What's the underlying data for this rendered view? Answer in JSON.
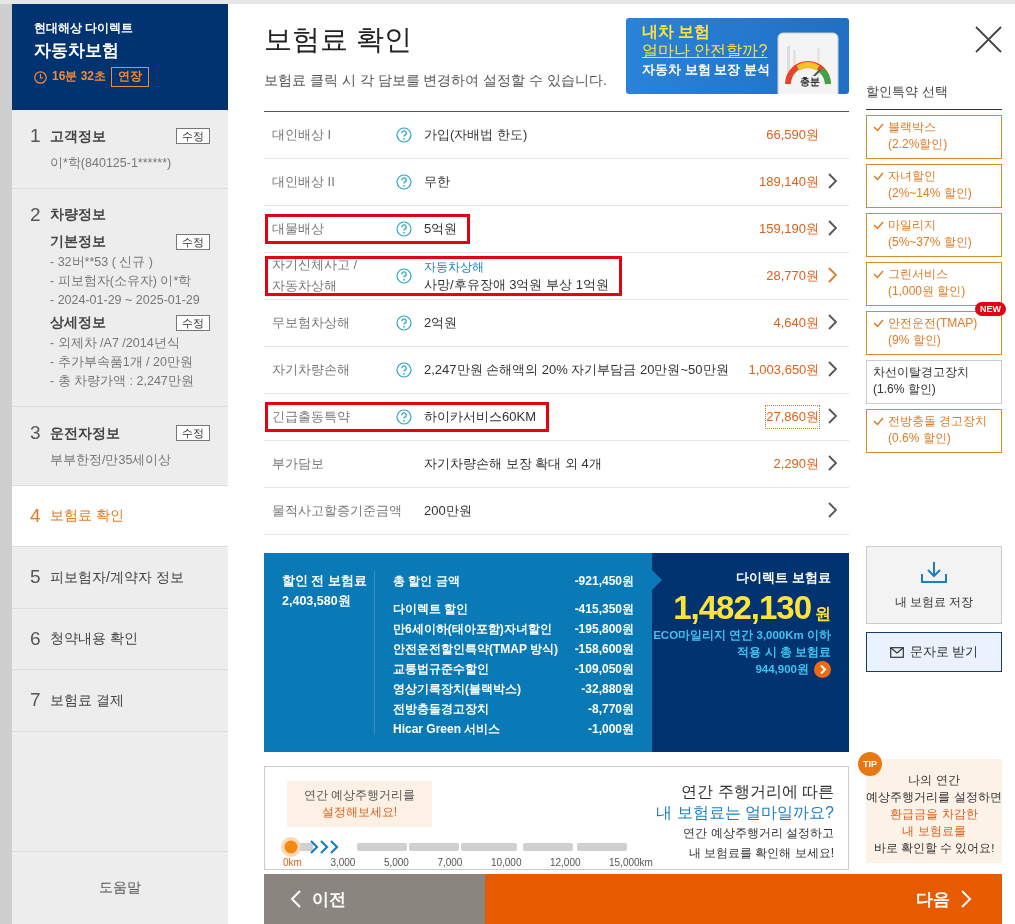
{
  "sidebar": {
    "brand": "현대해상 다이렉트",
    "product": "자동차보험",
    "timer": "16분 32초",
    "extend_button": "연장",
    "steps": [
      {
        "number": "1",
        "title": "고객정보",
        "selected": false,
        "edit_button": "수정",
        "lines": [
          "이*학(840125-1******)"
        ]
      },
      {
        "number": "2",
        "title": "차량정보",
        "selected": false,
        "sections": [
          {
            "title": "기본정보",
            "edit_button": "수정",
            "lines": [
              "- 32버**53 ( 신규 )",
              "- 피보험자(소유자) 이*학",
              "- 2024-01-29 ~ 2025-01-29"
            ]
          },
          {
            "title": "상세정보",
            "edit_button": "수정",
            "lines": [
              "- 외제차 /A7 /2014년식",
              "- 추가부속품1개 / 20만원",
              "- 총 차량가액 : 2,247만원"
            ]
          }
        ]
      },
      {
        "number": "3",
        "title": "운전자정보",
        "selected": false,
        "edit_button": "수정",
        "lines": [
          "부부한정/만35세이상"
        ]
      },
      {
        "number": "4",
        "title": "보험료 확인",
        "selected": true
      },
      {
        "number": "5",
        "title": "피보험자/계약자 정보",
        "selected": false
      },
      {
        "number": "6",
        "title": "청약내용 확인",
        "selected": false
      },
      {
        "number": "7",
        "title": "보험료 결제",
        "selected": false
      }
    ],
    "help": "도움말"
  },
  "header": {
    "title": "보험료 확인",
    "subtitle": "보험료 클릭 시 각 담보를 변경하여 설정할 수 있습니다.",
    "banner": {
      "line_1": "내차 보험",
      "line_2": "얼마나 안전할까?",
      "line_3": "자동차 보험 보장 분석",
      "gauge_label": "충분"
    }
  },
  "coverages": [
    {
      "label": "대인배상 I",
      "help": true,
      "value": "가입(자배법 한도)",
      "amount": "66,590원",
      "chevron": false,
      "highlighted": false
    },
    {
      "label": "대인배상 II",
      "help": true,
      "value": "무한",
      "amount": "189,140원",
      "chevron": true,
      "highlighted": false
    },
    {
      "label": "대물배상",
      "help": true,
      "value": "5억원",
      "amount": "159,190원",
      "chevron": true,
      "highlighted": true
    },
    {
      "label": "자기신체사고 / 자동차상해",
      "help": true,
      "note": "자동차상해",
      "value": "사망/후유장애 3억원 부상 1억원",
      "amount": "28,770원",
      "chevron": true,
      "highlighted": true,
      "hover": true
    },
    {
      "label": "무보험차상해",
      "help": true,
      "value": "2억원",
      "amount": "4,640원",
      "chevron": true,
      "highlighted": false
    },
    {
      "label": "자기차량손해",
      "help": true,
      "value": "2,247만원 손해액의 20% 자기부담금 20만원~50만원",
      "amount": "1,003,650원",
      "chevron": true,
      "highlighted": false
    },
    {
      "label": "긴급출동특약",
      "help": true,
      "value": "하이카서비스60KM",
      "amount": "27,860원",
      "chevron": true,
      "highlighted": true,
      "focused": true
    },
    {
      "label": "부가담보",
      "help": false,
      "value": "자기차량손해 보장 확대 외 4개",
      "amount": "2,290원",
      "chevron": true,
      "highlighted": false
    },
    {
      "label": "물적사고할증기준금액",
      "help": false,
      "value": "200만원",
      "chevron": true,
      "highlighted": false
    }
  ],
  "summary": {
    "before_label": "할인 전 보험료",
    "before_amount": "2,403,580원",
    "discounts": [
      {
        "kind": "total",
        "label": "총 할인 금액",
        "amount": "-921,450원"
      },
      {
        "kind": "item",
        "label": "다이렉트 할인",
        "amount": "-415,350원"
      },
      {
        "kind": "item",
        "label": "만6세이하(태아포함)자녀할인",
        "amount": "-195,800원"
      },
      {
        "kind": "item",
        "label": "안전운전할인특약(TMAP 방식)",
        "amount": "-158,600원"
      },
      {
        "kind": "item",
        "label": "교통법규준수할인",
        "amount": "-109,050원"
      },
      {
        "kind": "item",
        "label": "영상기록장치(블랙박스)",
        "amount": "-32,880원"
      },
      {
        "kind": "item",
        "label": "전방충돌경고장치",
        "amount": "-8,770원"
      },
      {
        "kind": "item",
        "label": "Hicar Green 서비스",
        "amount": "-1,000원"
      }
    ],
    "final_label": "다이렉트 보험료",
    "final_amount": "1,482,130",
    "final_unit": "원",
    "eco_lines": [
      "ECO마일리지 연간 3,000Km 이하",
      "적용 시 총 보험료"
    ],
    "eco_amount": "944,900원"
  },
  "mileage": {
    "prompt_line_1": "연간 예상주행거리를",
    "prompt_line_2": "설정해보세요!",
    "slider": {
      "level": 0
    },
    "ticks": [
      "0km",
      "3,000",
      "5,000",
      "7,000",
      "10,000",
      "12,000",
      "15,000km"
    ],
    "headline_1": "연간 주행거리에 따른",
    "headline_2": "내 보험료는 얼마일까요?",
    "hint_lines": [
      "연간 예상주행거리 설정하고",
      "내 보험료를 확인해 보세요!"
    ]
  },
  "discount_panel": {
    "title": "할인특약 선택",
    "options": [
      {
        "name": "블랙박스",
        "rate": "(2.2%할인)",
        "checked": true
      },
      {
        "name": "자녀할인",
        "rate": "(2%~14% 할인)",
        "checked": true
      },
      {
        "name": "마일리지",
        "rate": "(5%~37% 할인)",
        "checked": true
      },
      {
        "name": "그린서비스",
        "rate": "(1,000원 할인)",
        "checked": true
      },
      {
        "name": "안전운전(TMAP)",
        "rate": "(9% 할인)",
        "checked": true,
        "badge": "NEW"
      },
      {
        "name": "차선이탈경고장치",
        "rate": "(1.6% 할인)",
        "checked": false
      },
      {
        "name": "전방충돌 경고장치",
        "rate": "(0.6% 할인)",
        "checked": true
      }
    ]
  },
  "save_button": "내 보험료 저장",
  "sms_button": "문자로 받기",
  "tip": {
    "badge": "TIP",
    "lines": [
      {
        "text": "나의 연간",
        "accent": false
      },
      {
        "text": "예상주행거리를 설정하면",
        "accent": false
      },
      {
        "text": "환급금을 차감한",
        "accent": true
      },
      {
        "text": "내 보험료를",
        "accent": true
      },
      {
        "text": "바로 확인할 수 있어요!",
        "accent": false
      }
    ]
  },
  "footer": {
    "prev": "이전",
    "next": "다음"
  }
}
